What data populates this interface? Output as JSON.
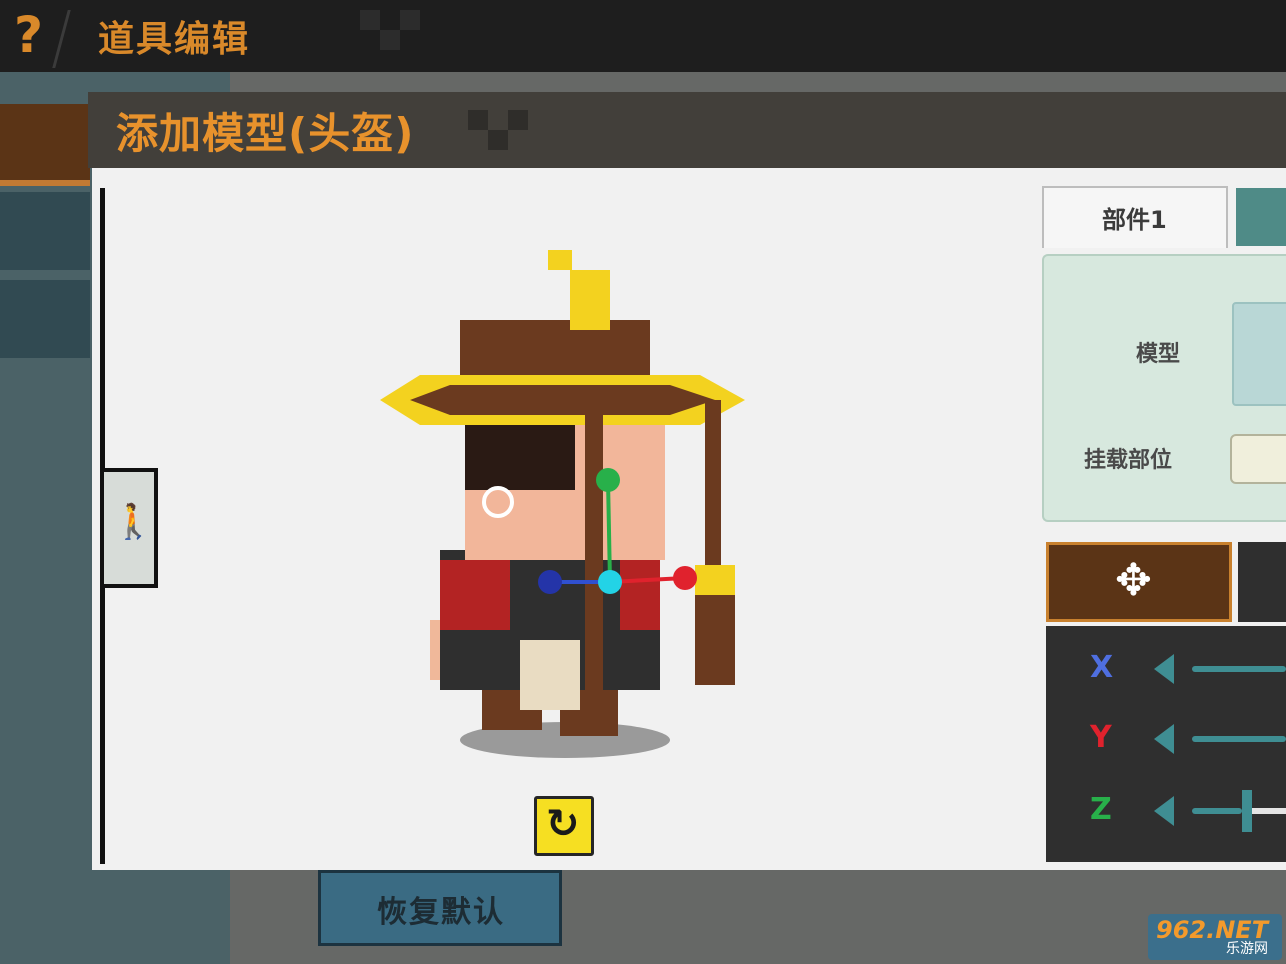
{
  "header": {
    "help_icon": "?",
    "title": "道具编辑"
  },
  "modal": {
    "title": "添加模型(头盔)"
  },
  "side_tab": {
    "icon": "figure-icon"
  },
  "tabs": [
    {
      "label": "部件1"
    }
  ],
  "properties": {
    "model_label": "模型",
    "mount_label": "挂载部位"
  },
  "transform": {
    "mode_icon": "move-arrows-icon",
    "axes": [
      "X",
      "Y",
      "Z"
    ]
  },
  "buttons": {
    "restore_label": "恢复默认",
    "rotate_icon": "↻"
  },
  "watermark": {
    "brand": "962.NET",
    "sub": "乐游网"
  },
  "colors": {
    "accent": "#e8922c",
    "axis_x": "#4f6fe0",
    "axis_y": "#e0222d",
    "axis_z": "#28b04a",
    "slider": "#3f8e93"
  }
}
